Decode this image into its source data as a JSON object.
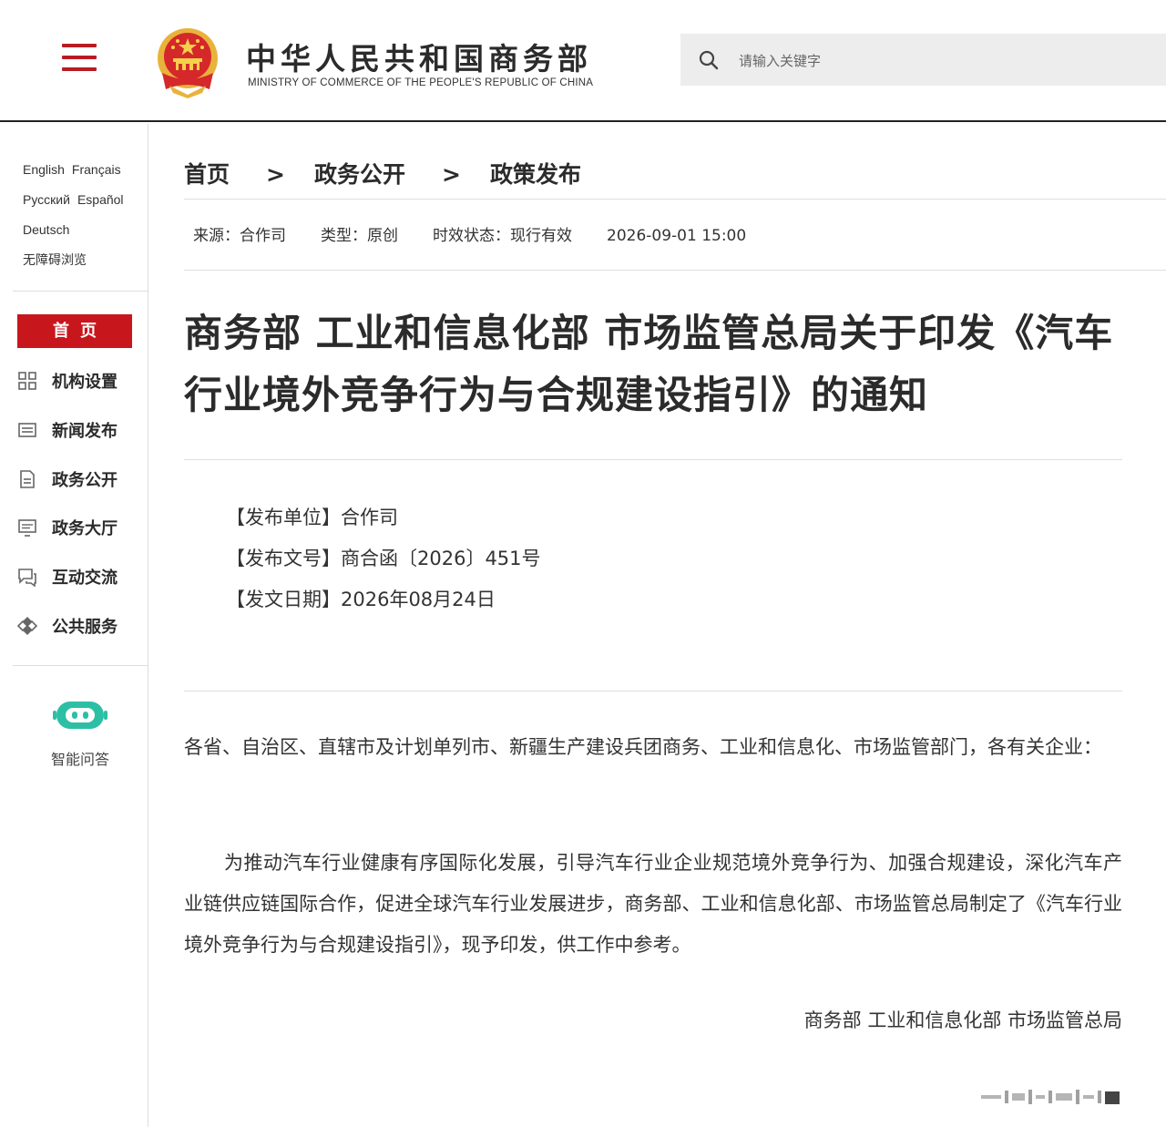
{
  "header": {
    "brand_cn": "中华人民共和国商务部",
    "brand_en": "MINISTRY OF COMMERCE OF THE PEOPLE'S REPUBLIC OF CHINA",
    "search_placeholder": "请输入关键字",
    "menu_icon": "hamburger-menu-icon",
    "emblem_icon": "national-emblem-icon",
    "accent_color": "#c8161d"
  },
  "sidebar": {
    "languages": [
      [
        "English",
        "Français"
      ],
      [
        "Русский",
        "Español"
      ],
      [
        "Deutsch"
      ],
      [
        "无障碍浏览"
      ]
    ],
    "home": "首页",
    "items": [
      {
        "label": "机构设置",
        "icon": "org-grid-icon"
      },
      {
        "label": "新闻发布",
        "icon": "news-list-icon"
      },
      {
        "label": "政务公开",
        "icon": "document-icon"
      },
      {
        "label": "政务大厅",
        "icon": "monitor-icon"
      },
      {
        "label": "互动交流",
        "icon": "chat-bubble-icon"
      },
      {
        "label": "公共服务",
        "icon": "service-diamond-icon"
      }
    ],
    "assistant": {
      "label": "智能问答",
      "icon": "robot-icon"
    }
  },
  "breadcrumb": [
    "首页",
    "政务公开",
    "政策发布"
  ],
  "breadcrumb_sep": ">",
  "meta": {
    "source": "来源：合作司",
    "type": "类型：原创",
    "status": "时效状态：现行有效",
    "datetime": "2026-09-01 15:00"
  },
  "article": {
    "title": "商务部 工业和信息化部 市场监管总局关于印发《汽车行业境外竞争行为与合规建设指引》的通知",
    "info": [
      "【发布单位】合作司",
      "【发布文号】商合函〔2026〕451号",
      "【发文日期】2026年08月24日"
    ],
    "salutation": "各省、自治区、直辖市及计划单列市、新疆生产建设兵团商务、工业和信息化、市场监管部门，各有关企业：",
    "body": "为推动汽车行业健康有序国际化发展，引导汽车行业企业规范境外竞争行为、加强合规建设，深化汽车产业链供应链国际合作，促进全球汽车行业发展进步，商务部、工业和信息化部、市场监管总局制定了《汽车行业境外竞争行为与合规建设指引》，现予印发，供工作中参考。",
    "signature": "商务部 工业和信息化部 市场监管总局"
  }
}
